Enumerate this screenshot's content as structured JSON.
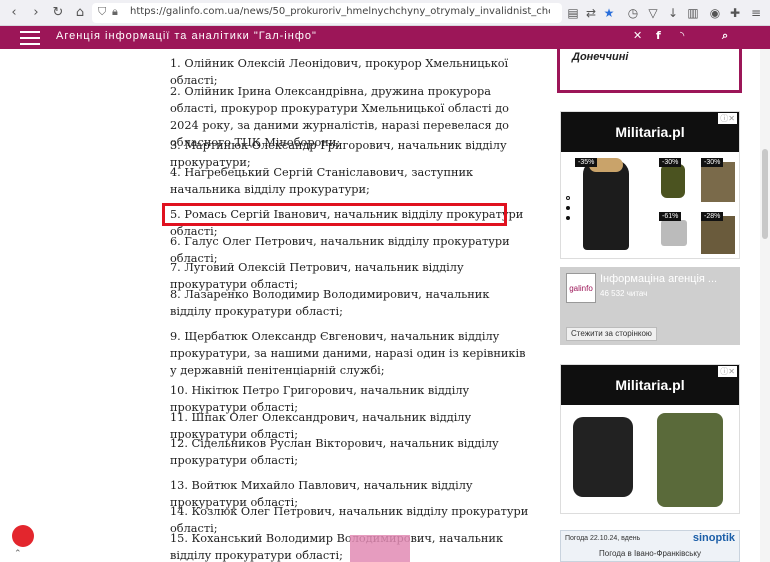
{
  "browser": {
    "url": "https://galinfo.com.ua/news/50_prokuroriv_hmelnychchyny_otrymaly_invalidnist_cherez_kerivnytsyu_msek_krupu_4..."
  },
  "header": {
    "title": "Агенція інформації та аналітики \"Гал-інфо\""
  },
  "article": {
    "items": [
      "1. Олійник Олексій Леонідович, прокурор Хмельницької області;",
      "2. Олійник Ірина Олександрівна, дружина прокурора області, прокурор прокуратури Хмельницької області до 2024 року, за даними журналістів, наразі перевелася до обласного ТЦК Міноборони;",
      "3. Мартинюк Олександр Григорович, начальник відділу прокуратури;",
      "4. Нагребецький Сергій Станіславович, заступник начальника відділу прокуратури;",
      "5. Ромась Сергій Іванович, начальник відділу прокуратури області;",
      "6. Галус Олег Петрович, начальник відділу прокуратури області;",
      "7. Луговий Олексій Петрович, начальник відділу прокуратури області;",
      "8. Лазаренко Володимир Володимирович, начальник відділу прокуратури області;",
      "9. Щербатюк Олександр Євгенович, начальник відділу прокуратури, за нашими даними, наразі один із керівників у державній пенітенціарній службі;",
      "10. Нікітюк Петро Григорович, начальник відділу прокуратури області;",
      "11. Шпак Олег Олександрович, начальник відділу прокуратури області;",
      "12. Сідельников Руслан Вікторович, начальник відділу прокуратури області;",
      "13. Войтюк Михайло Павлович, начальник відділу прокуратури області;",
      "14. Козлюк Олег Петрович, начальник відділу прокуратури області;",
      "15. Коханський Володимир Володимирович, начальник відділу прокуратури області;"
    ]
  },
  "sidebar": {
    "box_text": "Донеччині",
    "ad1": {
      "brand": "Militaria.pl",
      "badges": [
        "-35%",
        "-30%",
        "-30%",
        "-61%",
        "-28%"
      ]
    },
    "fb": {
      "title": "Інформаціна агенція ...",
      "likes": "46 532 читач",
      "logo": "galinfo",
      "follow": "Стежити за сторінкою"
    },
    "ad2": {
      "brand": "Militaria.pl"
    },
    "weather": {
      "date": "Погода 22.10.24, вдень",
      "logo": "sinoptik",
      "city": "Погода в Івано-Франківську"
    }
  },
  "colors": {
    "brand": "#9c1658",
    "highlight": "#e0111f"
  }
}
